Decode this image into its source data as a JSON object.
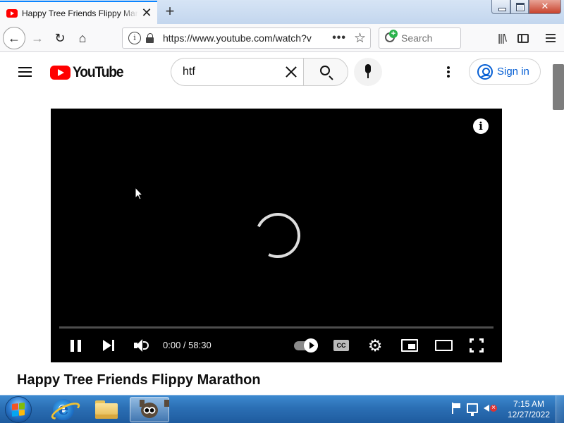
{
  "browser": {
    "tab": {
      "title": "Happy Tree Friends Flippy Marathon",
      "close_glyph": "✕"
    },
    "new_tab_glyph": "+",
    "nav": {
      "back_glyph": "←",
      "forward_glyph": "→",
      "reload_glyph": "↻",
      "home_glyph": "⌂"
    },
    "urlbar": {
      "info_glyph": "i",
      "url": "https://www.youtube.com/watch?v",
      "more_glyph": "•••",
      "bookmark_glyph": "☆"
    },
    "search": {
      "placeholder": "Search"
    },
    "library_glyph": "|||\\"
  },
  "youtube": {
    "logo_text": "YouTube",
    "search_query": "htf",
    "signin_label": "Sign in",
    "player": {
      "info_glyph": "i",
      "time_display": "0:00 / 58:30",
      "progress_percent": 0,
      "cc_label": "CC",
      "gear_glyph": "⚙"
    },
    "video_title": "Happy Tree Friends Flippy Marathon"
  },
  "taskbar": {
    "ie_glyph": "e",
    "clock": {
      "time": "7:15 AM",
      "date": "12/27/2022"
    },
    "start_flag_colors": [
      "#f35325",
      "#81bc06",
      "#05a6f0",
      "#ffba08"
    ]
  },
  "colors": {
    "youtube_red": "#ff0000",
    "link_blue": "#065fd4",
    "firefox_accent": "#0a84ff"
  }
}
